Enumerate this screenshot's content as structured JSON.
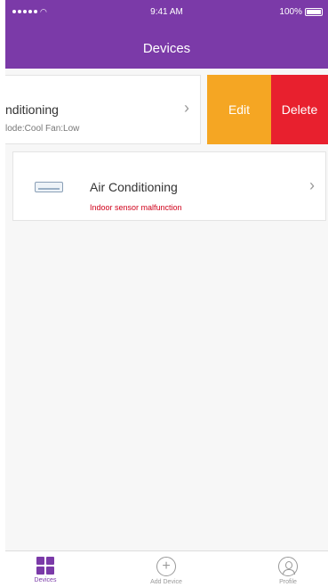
{
  "status_bar": {
    "time": "9:41 AM",
    "battery": "100%"
  },
  "header": {
    "title": "Devices"
  },
  "swiped_row": {
    "name": "nditioning",
    "sub": "lode:Cool   Fan:Low",
    "actions": {
      "edit": "Edit",
      "delete": "Delete"
    }
  },
  "device_row": {
    "name": "Air Conditioning",
    "error": "Indoor sensor malfunction"
  },
  "tabbar": {
    "tabs": [
      {
        "label": "Devices",
        "icon": "grid-icon",
        "active": true
      },
      {
        "label": "Add Device",
        "icon": "plus-circle-icon",
        "active": false
      },
      {
        "label": "Profile",
        "icon": "profile-icon",
        "active": false
      }
    ]
  },
  "colors": {
    "header": "#7b3aa8",
    "edit": "#f5a623",
    "delete": "#e8202e",
    "error": "#d0021b"
  }
}
